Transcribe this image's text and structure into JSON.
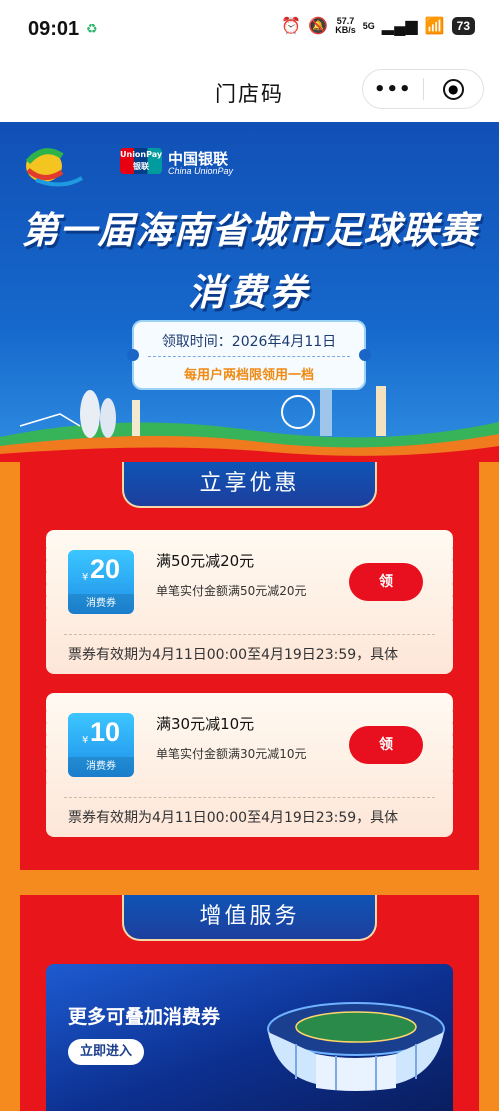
{
  "status_bar": {
    "time": "09:01",
    "speed_value": "57.7",
    "speed_unit": "KB/s",
    "network": "5G",
    "battery": "73"
  },
  "title_bar": {
    "title": "门店码"
  },
  "banner": {
    "unionpay_logo_line1": "UnionPay",
    "unionpay_logo_line2": "银联",
    "unionpay_name": "中国银联",
    "unionpay_en": "China UnionPay",
    "title": "第一届海南省城市足球联赛",
    "subtitle": "消费券",
    "claim_time": "领取时间：2026年4月11日",
    "limit_note": "每用户两档限领用一档"
  },
  "offers_section": {
    "header": "立享优惠",
    "coupons": [
      {
        "currency": "¥",
        "amount": "20",
        "badge": "消费券",
        "title": "满50元减20元",
        "desc": "单笔实付金额满50元减20元",
        "button": "领",
        "validity": "票券有效期为4月11日00:00至4月19日23:59，具体"
      },
      {
        "currency": "¥",
        "amount": "10",
        "badge": "消费券",
        "title": "满30元减10元",
        "desc": "单笔实付金额满30元减10元",
        "button": "领",
        "validity": "票券有效期为4月11日00:00至4月19日23:59，具体"
      }
    ]
  },
  "services_section": {
    "header": "增值服务",
    "card_title": "更多可叠加消费券",
    "card_button": "立即进入"
  },
  "colors": {
    "accent_red": "#e8161b",
    "tab_blue": "#1d4fb0",
    "page_orange": "#f58a1f",
    "claim_button": "#e8101e"
  }
}
